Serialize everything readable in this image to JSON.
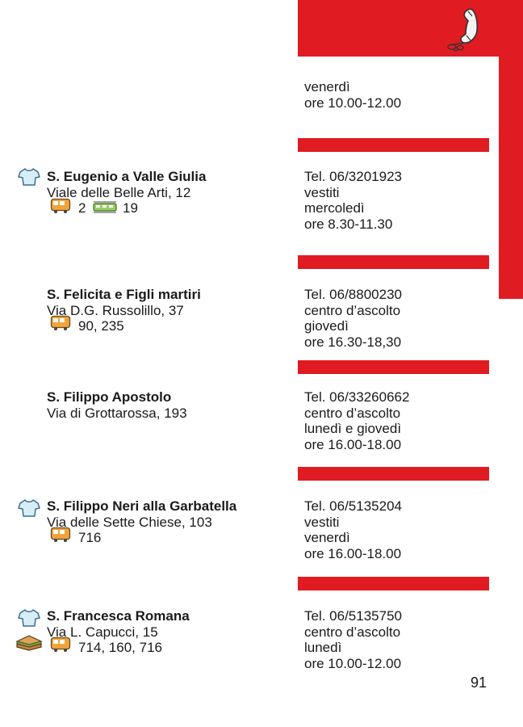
{
  "colors": {
    "accent": "#e01b22",
    "text": "#1a1a1a",
    "background": "#ffffff"
  },
  "header_icon": "telephone-icon",
  "first_block": {
    "day": "venerdì",
    "hours": "ore 10.00-12.00"
  },
  "entries": [
    {
      "name": "S. Eugenio a Valle Giulia",
      "address": "Viale delle Belle Arti, 12",
      "bus_routes": "2",
      "tram_routes": "19",
      "service_icons": [
        "shirt-icon"
      ],
      "phone": "Tel. 06/3201923",
      "service": "vestiti",
      "day": "mercoledì",
      "hours": "ore 8.30-11.30"
    },
    {
      "name": "S. Felicita e Figli martiri",
      "address": "Via D.G. Russolillo, 37",
      "bus_routes": "90, 235",
      "service_icons": [],
      "phone": "Tel. 06/8800230",
      "service": "centro d’ascolto",
      "day": "giovedì",
      "hours": "ore 16.30-18,30"
    },
    {
      "name": "S. Filippo Apostolo",
      "address": "Via di Grottarossa, 193",
      "service_icons": [],
      "phone": "Tel. 06/33260662",
      "service": "centro d’ascolto",
      "day": "lunedì e giovedì",
      "hours": "ore 16.00-18.00"
    },
    {
      "name": "S. Filippo Neri alla Garbatella",
      "address": "Via delle Sette Chiese, 103",
      "bus_routes": "716",
      "service_icons": [
        "shirt-icon"
      ],
      "phone": "Tel. 06/5135204",
      "service": "vestiti",
      "day": "venerdì",
      "hours": "ore 16.00-18.00"
    },
    {
      "name": "S. Francesca Romana",
      "address": "Via L. Capucci, 15",
      "bus_routes": "714, 160, 716",
      "service_icons": [
        "shirt-icon",
        "sandwich-icon"
      ],
      "phone": "Tel. 06/5135750",
      "service": "centro d’ascolto",
      "day": "lunedì",
      "hours": "ore 10.00-12.00"
    }
  ],
  "page_number": "91"
}
